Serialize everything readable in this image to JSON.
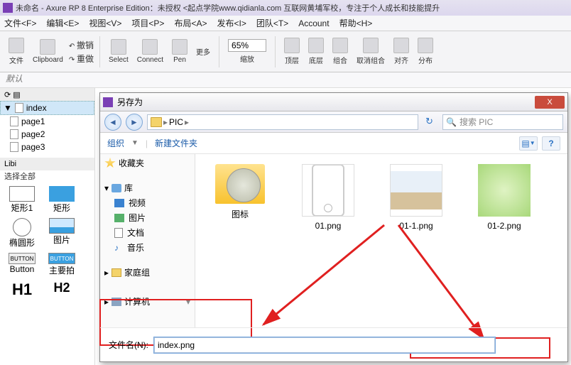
{
  "title": "未命名 - Axure RP 8 Enterprise Edition：未授权     <起点学院www.qidianla.com 互联网黄埔军校，专注于个人成长和技能提升",
  "menu": [
    "文件<F>",
    "编辑<E>",
    "视图<V>",
    "项目<P>",
    "布局<A>",
    "发布<I>",
    "团队<T>",
    "Account",
    "帮助<H>"
  ],
  "tb": {
    "file": "文件",
    "clipboard": "Clipboard",
    "undo": "撤销",
    "redo": "重做",
    "select": "Select",
    "connect": "Connect",
    "pen": "Pen",
    "more": "更多",
    "zoom": "65%",
    "textedit": "缩放",
    "top": "顶层",
    "bottom": "底层",
    "group": "组合",
    "ungroup": "取消组合",
    "align": "对齐",
    "distribute": "分布"
  },
  "row2": {
    "default": "默认"
  },
  "left": {
    "index": "index",
    "p1": "page1",
    "p2": "page2",
    "p3": "page3",
    "lib": "Libi",
    "selall": "选择全部",
    "shape_rect1": "矩形1",
    "shape_rect2": "矩形",
    "shape_ellipse": "椭圆形",
    "shape_img": "图片",
    "shape_button": "Button",
    "shape_btnlabel": "Button",
    "shape_main": "主要拍",
    "h1": "H1",
    "h2": "H2",
    "btn": "BUTTON"
  },
  "dialog": {
    "title": "另存为",
    "crumb_folder": "PIC",
    "search_placeholder": "搜索 PIC",
    "org": "组织",
    "newf": "新建文件夹",
    "side": {
      "fav": "收藏夹",
      "lib": "库",
      "vid": "视频",
      "pic": "图片",
      "doc": "文档",
      "mus": "音乐",
      "home": "家庭组",
      "comp": "计算机"
    },
    "files": [
      {
        "name": "图标",
        "type": "folder"
      },
      {
        "name": "01.png",
        "type": "phone"
      },
      {
        "name": "01-1.png",
        "type": "land"
      },
      {
        "name": "01-2.png",
        "type": "green"
      }
    ],
    "filename_label": "文件名(N):",
    "filename_value": "index.png",
    "close": "X"
  }
}
